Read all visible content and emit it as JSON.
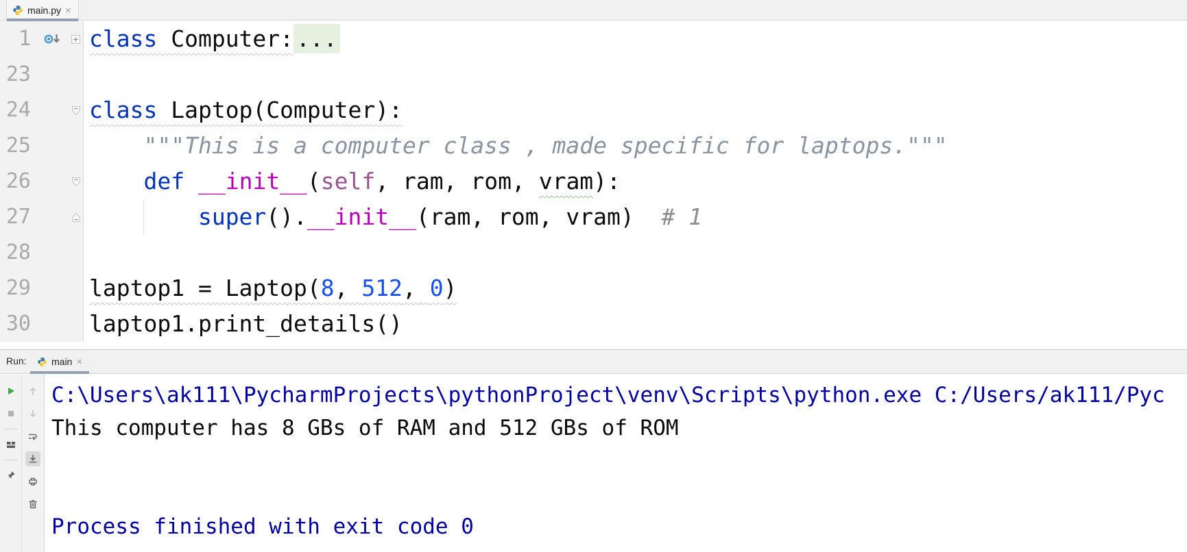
{
  "editor": {
    "tab": {
      "label": "main.py",
      "close": "×"
    },
    "lines": [
      {
        "num": "1",
        "gutter": "class-inheritors-icon",
        "fold": "fold-collapsed-icon",
        "tokens": [
          {
            "t": "class ",
            "s": "kw u-gray"
          },
          {
            "t": "Computer:",
            "s": "id u-gray"
          },
          {
            "t": "...",
            "s": "folded"
          }
        ]
      },
      {
        "num": "23",
        "tokens": []
      },
      {
        "num": "24",
        "fold": "fold-open-start-icon",
        "tokens": [
          {
            "t": "class ",
            "s": "kw u-gray"
          },
          {
            "t": "Laptop(Computer):",
            "s": "id u-gray"
          }
        ]
      },
      {
        "num": "25",
        "tokens": [
          {
            "t": "    ",
            "s": "id"
          },
          {
            "t": "\"\"\"This is a computer class , made specific for laptops.\"\"\"",
            "s": "doc"
          }
        ]
      },
      {
        "num": "26",
        "fold": "fold-open-start-icon",
        "tokens": [
          {
            "t": "    ",
            "s": "id"
          },
          {
            "t": "def ",
            "s": "kw"
          },
          {
            "t": "__init__",
            "s": "magic"
          },
          {
            "t": "(",
            "s": "id"
          },
          {
            "t": "self",
            "s": "self"
          },
          {
            "t": ", ram, rom, ",
            "s": "id"
          },
          {
            "t": "vram",
            "s": "id u-green"
          },
          {
            "t": "):",
            "s": "id"
          }
        ]
      },
      {
        "num": "27",
        "fold": "fold-open-end-icon",
        "tokens": [
          {
            "t": "        ",
            "s": "id"
          },
          {
            "t": "super",
            "s": "kw"
          },
          {
            "t": "().",
            "s": "id"
          },
          {
            "t": "__init__",
            "s": "magic"
          },
          {
            "t": "(ram, rom, vram)",
            "s": "id"
          },
          {
            "t": "  ",
            "s": "id"
          },
          {
            "t": "# 1",
            "s": "cm"
          }
        ]
      },
      {
        "num": "28",
        "tokens": []
      },
      {
        "num": "29",
        "tokens": [
          {
            "t": "laptop1 = Laptop(",
            "s": "id u-gray"
          },
          {
            "t": "8",
            "s": "num u-gray"
          },
          {
            "t": ", ",
            "s": "id u-gray"
          },
          {
            "t": "512",
            "s": "num u-gray"
          },
          {
            "t": ", ",
            "s": "id u-gray"
          },
          {
            "t": "0",
            "s": "num u-gray"
          },
          {
            "t": ")",
            "s": "id u-gray"
          }
        ]
      },
      {
        "num": "30",
        "tokens": [
          {
            "t": "laptop1.print_details()",
            "s": "id"
          }
        ]
      }
    ]
  },
  "run": {
    "label": "Run:",
    "tab": {
      "label": "main",
      "close": "×"
    },
    "console": [
      {
        "s": "system",
        "t": "C:\\Users\\ak111\\PycharmProjects\\pythonProject\\venv\\Scripts\\python.exe C:/Users/ak111/Pyc"
      },
      {
        "s": "stdout",
        "t": "This computer has 8 GBs of RAM and 512 GBs of ROM"
      },
      {
        "s": "stdout",
        "t": ""
      },
      {
        "s": "stdout",
        "t": ""
      },
      {
        "s": "system",
        "t": "Process finished with exit code 0"
      }
    ]
  },
  "icons": {
    "python_icon": "python-logo",
    "close_icon": "×",
    "class_inheritors_icon": "circle-with-down-arrow",
    "fold_collapsed_icon": "plus-box",
    "fold_open_start_icon": "pentagon-down",
    "fold_open_end_icon": "pentagon-up",
    "bulb_icon": "yellow-lightbulb",
    "rerun_icon": "green-play-triangle",
    "stop_icon": "gray-square",
    "restore_layout_icon": "layout-blocks",
    "pin_icon": "pushpin",
    "up_icon": "arrow-up",
    "down_icon": "arrow-down",
    "soft_wrap_icon": "curved-wrap-arrow",
    "scroll_to_end_icon": "arrow-to-line",
    "print_icon": "printer",
    "clear_icon": "trash-can"
  },
  "colors": {
    "keyword": "#0033B3",
    "magic_method": "#B200B2",
    "self_param": "#94558D",
    "number": "#1750EB",
    "comment": "#8C8C8C",
    "docstring": "#8A939E",
    "folded_bg": "#E6F2DF",
    "console_system": "#00009C",
    "tab_underline": "#92A1B1",
    "gutter_bg": "#F2F2F2",
    "run_play": "#47A447"
  }
}
